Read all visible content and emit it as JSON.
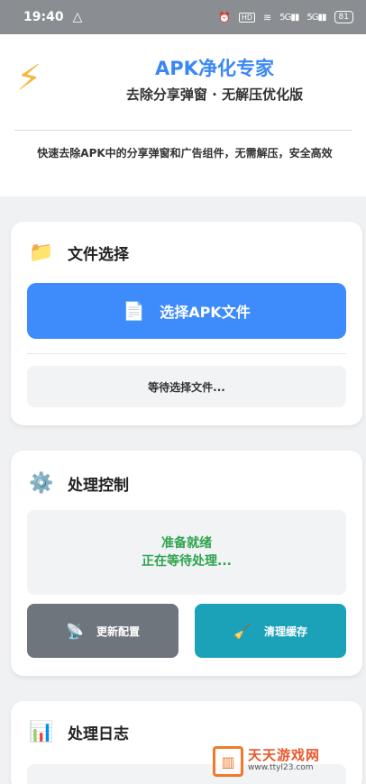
{
  "status_bar": {
    "time": "19:40",
    "hd": "HD",
    "signal_1": "5G",
    "signal_2": "5G",
    "battery": "81",
    "icons": [
      "app-triangle-icon",
      "alarm-icon",
      "wifi-icon",
      "signal-icon",
      "battery-icon"
    ]
  },
  "header": {
    "icon": "lightning-icon",
    "title": "APK净化专家",
    "subtitle": "去除分享弹窗 · 无解压优化版",
    "description": "快速去除APK中的分享弹窗和广告组件，无需解压，安全高效"
  },
  "file_card": {
    "icon": "folder-icon",
    "title": "文件选择",
    "select_button": "选择APK文件",
    "status": "等待选择文件..."
  },
  "control_card": {
    "icon": "gear-icon",
    "title": "处理控制",
    "status_line1": "准备就绪",
    "status_line2": "正在等待处理...",
    "update_button": "更新配置",
    "clear_button": "清理缓存"
  },
  "log_card": {
    "icon": "bar-chart-icon",
    "title": "处理日志"
  },
  "watermark": {
    "name": "天天游戏网",
    "url": "www.ttyl23.com"
  },
  "colors": {
    "primary": "#3e8bfb",
    "success": "#2ea44f",
    "gray_button": "#6f757c",
    "teal_button": "#1ba2b8"
  }
}
